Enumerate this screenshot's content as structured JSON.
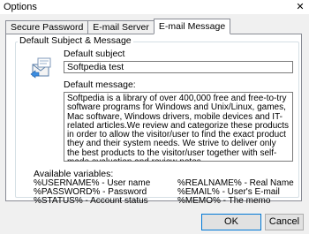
{
  "window": {
    "title": "Options",
    "close_glyph": "✕"
  },
  "tabs": [
    {
      "label": "Secure Password",
      "active": false
    },
    {
      "label": "E-mail Server",
      "active": false
    },
    {
      "label": "E-mail Message",
      "active": true
    }
  ],
  "group": {
    "title": "Default Subject & Message",
    "subject_label": "Default subject",
    "subject_value": "Softpedia test",
    "message_label": "Default message:",
    "message_value": "Softpedia is a library of over 400,000 free and free-to-try software programs for Windows and Unix/Linux, games, Mac software, Windows drivers, mobile devices and IT-related articles.We review and categorize these products in order to allow the visitor/user to find the exact product they and their system needs. We strive to deliver only the best products to the visitor/user together with self-made evaluation and review notes.",
    "variables_label": "Available variables:",
    "variables": [
      {
        "left": "%USERNAME% - User name",
        "right": "%REALNAME% - Real Name"
      },
      {
        "left": "%PASSWORD% - Password",
        "right": "%EMAIL% - User's E-mail"
      },
      {
        "left": "%STATUS% - Account status",
        "right": "%MEMO% - The memo"
      }
    ]
  },
  "buttons": {
    "ok": "OK",
    "cancel": "Cancel"
  },
  "icons": {
    "mail": "mail-envelope-icon"
  },
  "colors": {
    "tab_border": "#898c95",
    "button_focus": "#0078d7"
  }
}
